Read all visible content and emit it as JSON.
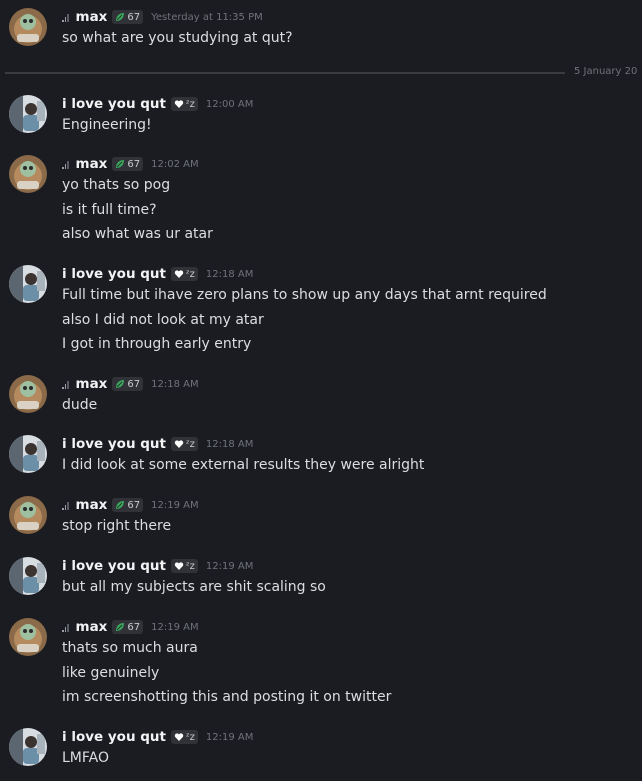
{
  "users": {
    "max": {
      "name": "max",
      "tag": "67",
      "tag_icon": "leaf-icon",
      "accent": "#3ba55c"
    },
    "qut": {
      "name": "i love you qut",
      "tag": "ᶻz",
      "tag_icon": "heart-icon"
    }
  },
  "divider": {
    "label": "5 January 20"
  },
  "messages": [
    {
      "user": "max",
      "time": "Yesterday at 11:35 PM",
      "lines": [
        "so what are you studying at qut?"
      ]
    },
    {
      "user": "qut",
      "time": "12:00 AM",
      "lines": [
        "Engineering!"
      ]
    },
    {
      "user": "max",
      "time": "12:02 AM",
      "lines": [
        "yo thats so pog",
        "is it full time?",
        "also what was ur atar"
      ]
    },
    {
      "user": "qut",
      "time": "12:18 AM",
      "lines": [
        "Full time but ihave zero plans to show up any days that arnt required",
        "also I did not look at my atar",
        "I got in through early entry"
      ]
    },
    {
      "user": "max",
      "time": "12:18 AM",
      "lines": [
        "dude"
      ]
    },
    {
      "user": "qut",
      "time": "12:18 AM",
      "lines": [
        "I did look at some external results they were alright"
      ]
    },
    {
      "user": "max",
      "time": "12:19 AM",
      "lines": [
        "stop right there"
      ]
    },
    {
      "user": "qut",
      "time": "12:19 AM",
      "lines": [
        "but all my subjects are shit scaling so"
      ]
    },
    {
      "user": "max",
      "time": "12:19 AM",
      "lines": [
        "thats so much aura",
        "like genuinely",
        "im screenshotting this and posting it on twitter"
      ]
    },
    {
      "user": "qut",
      "time": "12:19 AM",
      "lines": [
        "LMFAO"
      ]
    }
  ]
}
